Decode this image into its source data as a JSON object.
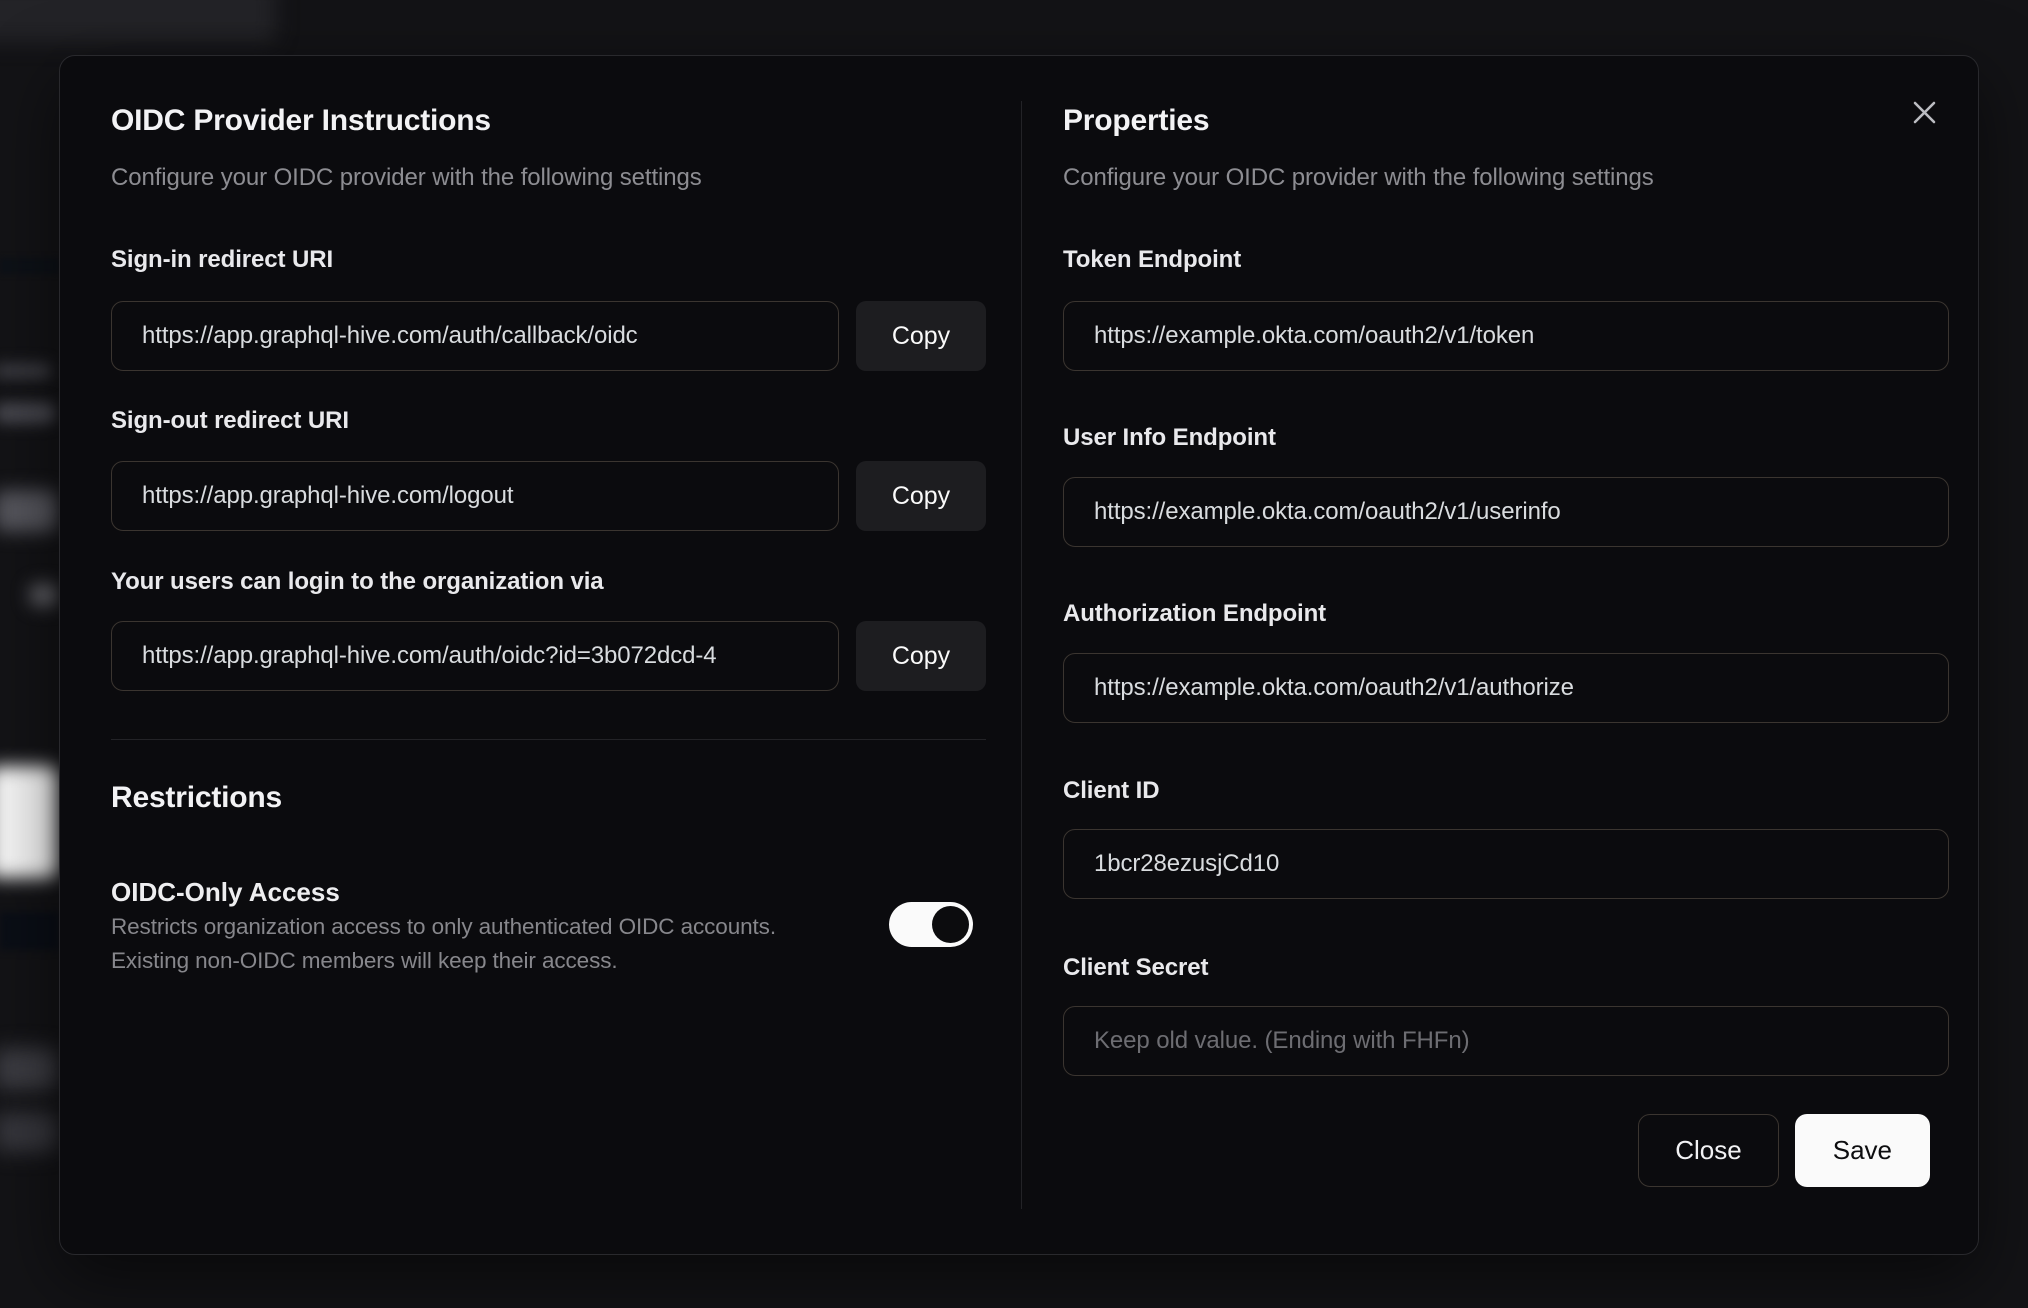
{
  "dialog": {
    "icons": {
      "close": "x-icon"
    },
    "left": {
      "title": "OIDC Provider Instructions",
      "subtitle": "Configure your OIDC provider with the following settings",
      "fields": [
        {
          "label": "Sign-in redirect URI",
          "value": "https://app.graphql-hive.com/auth/callback/oidc",
          "button": "Copy"
        },
        {
          "label": "Sign-out redirect URI",
          "value": "https://app.graphql-hive.com/logout",
          "button": "Copy"
        },
        {
          "label": "Your users can login to the organization via",
          "value": "https://app.graphql-hive.com/auth/oidc?id=3b072dcd-4",
          "button": "Copy"
        }
      ],
      "restrictions": {
        "title": "Restrictions",
        "toggle_label": "OIDC-Only Access",
        "description_line1": "Restricts organization access to only authenticated OIDC accounts.",
        "description_line2": "Existing non-OIDC members will keep their access.",
        "toggle_on": true
      }
    },
    "right": {
      "title": "Properties",
      "subtitle": "Configure your OIDC provider with the following settings",
      "fields": [
        {
          "label": "Token Endpoint",
          "value": "https://example.okta.com/oauth2/v1/token"
        },
        {
          "label": "User Info Endpoint",
          "value": "https://example.okta.com/oauth2/v1/userinfo"
        },
        {
          "label": "Authorization Endpoint",
          "value": "https://example.okta.com/oauth2/v1/authorize"
        },
        {
          "label": "Client ID",
          "value": "1bcr28ezusjCd10"
        },
        {
          "label": "Client Secret",
          "value": "",
          "placeholder": "Keep old value. (Ending with FHFn)"
        }
      ],
      "buttons": {
        "close": "Close",
        "save": "Save"
      }
    },
    "colors": {
      "dialog_background": "#0b0b0e",
      "page_background": "#131316",
      "input_border": "#3b3530",
      "copy_button_background": "#1d1d20",
      "save_button_background": "#fafafa",
      "toggle_on_track": "#fafafa"
    }
  }
}
